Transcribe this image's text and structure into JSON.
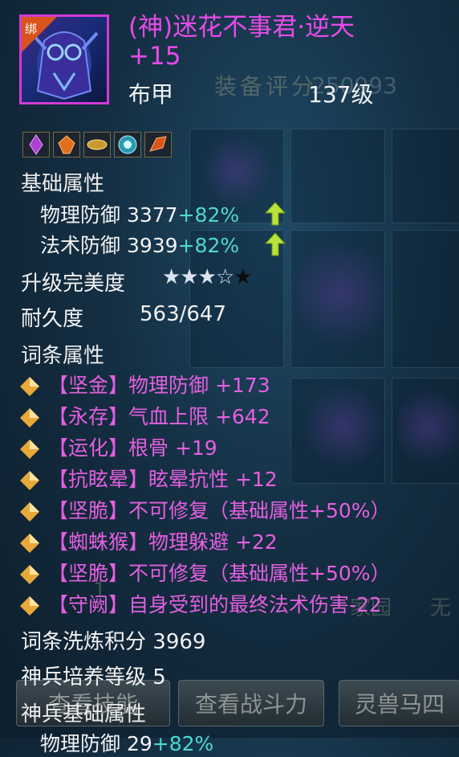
{
  "header": {
    "bind_badge": "绑",
    "title": "(神)迷花不事君·逆天 +15",
    "armor_type": "布甲",
    "level": "137级",
    "rating_label": "装备评分",
    "rating_value": "250993"
  },
  "gems": [
    "purple-gem-icon",
    "orange-gem-icon",
    "gold-gem-icon",
    "cyan-gem-icon",
    "orange-crystal-icon"
  ],
  "basic": {
    "title": "基础属性",
    "rows": [
      {
        "label": "物理防御",
        "value": "3377",
        "bonus": "+82%"
      },
      {
        "label": "法术防御",
        "value": "3939",
        "bonus": "+82%"
      }
    ]
  },
  "perfection": {
    "label": "升级完美度",
    "stars_filled": 3,
    "stars_total": 5
  },
  "durability": {
    "label": "耐久度",
    "value": "563/647"
  },
  "affixes": {
    "title": "词条属性",
    "rows": [
      {
        "text": "【坚金】物理防御 +173"
      },
      {
        "text": "【永存】气血上限 +642"
      },
      {
        "text": "【运化】根骨 +19"
      },
      {
        "text": "【抗眩晕】眩晕抗性 +12"
      },
      {
        "text": "【坚脆】不可修复（基础属性+50%）"
      },
      {
        "text": "【蜘蛛猴】物理躲避 +22"
      },
      {
        "text": "【坚脆】不可修复（基础属性+50%）"
      },
      {
        "text": "【守阙】自身受到的最终法术伤害-22"
      }
    ]
  },
  "refine": {
    "label": "词条洗炼积分",
    "value": "3969"
  },
  "cultivate": {
    "label": "神兵培养等级",
    "value": "5"
  },
  "divine": {
    "title": "神兵基础属性",
    "row": {
      "label": "物理防御",
      "value": "29",
      "bonus": "+82%"
    }
  },
  "bg_buttons": {
    "left": "查看技能",
    "middle": "查看战斗力",
    "right": "灵兽马四"
  },
  "colors": {
    "title": "#e84ae8",
    "bonus": "#4fd7d0",
    "affix": "#e45fe0",
    "arrow": "#b8e23a"
  }
}
